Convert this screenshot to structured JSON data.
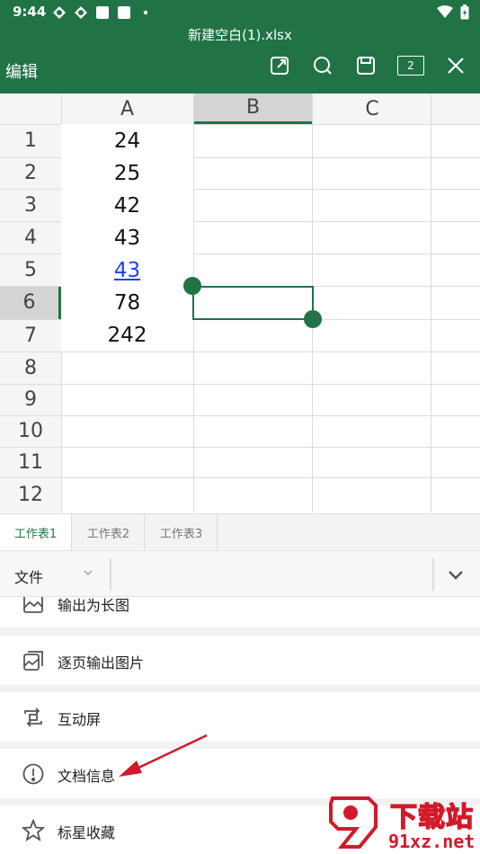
{
  "status_bar": {
    "time": "9:44"
  },
  "title_bar": {
    "file_name": "新建空白(1).xlsx"
  },
  "toolbar": {
    "edit_label": "编辑",
    "tab_count": "2"
  },
  "grid": {
    "columns": [
      "A",
      "B",
      "C"
    ],
    "rows": [
      "1",
      "2",
      "3",
      "4",
      "5",
      "6",
      "7",
      "8",
      "9",
      "10",
      "11",
      "12"
    ],
    "column_a_values": [
      "24",
      "25",
      "42",
      "43",
      "43",
      "78",
      "242"
    ],
    "selected_cell": "B6"
  },
  "sheet_tabs": [
    "工作表1",
    "工作表2",
    "工作表3"
  ],
  "file_bar": {
    "label": "文件"
  },
  "menu": {
    "items": [
      {
        "label": "输出为长图",
        "icon": "long-image-icon"
      },
      {
        "label": "逐页输出图片",
        "icon": "page-images-icon"
      },
      {
        "label": "互动屏",
        "icon": "interactive-screen-icon"
      },
      {
        "label": "文档信息",
        "icon": "info-icon"
      },
      {
        "label": "标星收藏",
        "icon": "star-icon"
      }
    ]
  },
  "watermark": {
    "brand": "下载站",
    "domain": "91xz.net"
  },
  "colors": {
    "accent": "#217346",
    "link": "#1e40ff",
    "annotation": "#d11a2a"
  }
}
